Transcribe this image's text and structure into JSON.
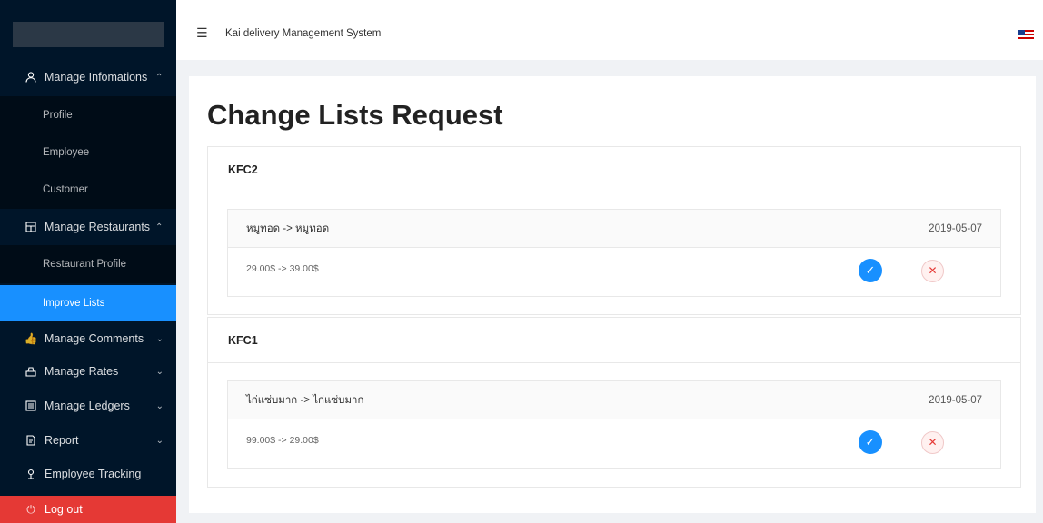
{
  "header": {
    "title": "Kai delivery Management System"
  },
  "sidebar": {
    "items": [
      {
        "label": "Manage Infomations",
        "icon": "user-icon",
        "arrow": "^"
      },
      {
        "label": "Profile"
      },
      {
        "label": "Employee"
      },
      {
        "label": "Customer"
      },
      {
        "label": "Manage Restaurants",
        "icon": "shop-icon",
        "arrow": "^"
      },
      {
        "label": "Restaurant Profile"
      },
      {
        "label": "Improve Lists"
      },
      {
        "label": "Manage Comments",
        "icon": "like-icon",
        "arrow": "v"
      },
      {
        "label": "Manage Rates",
        "icon": "rate-icon",
        "arrow": "v"
      },
      {
        "label": "Manage Ledgers",
        "icon": "ledger-icon",
        "arrow": "v"
      },
      {
        "label": "Report",
        "icon": "report-icon",
        "arrow": "v"
      },
      {
        "label": "Employee Tracking",
        "icon": "tracking-icon"
      },
      {
        "label": "Log out",
        "icon": "logout-icon"
      }
    ]
  },
  "main": {
    "title": "Change Lists Request",
    "cards": [
      {
        "restaurant": "KFC2",
        "name_change": "หมูทอด -> หมูทอด",
        "date": "2019-05-07",
        "price_change": "29.00$ -> 39.00$"
      },
      {
        "restaurant": "KFC1",
        "name_change": "ไก่แซ่บมาก -> ไก่แซ่บมาก",
        "date": "2019-05-07",
        "price_change": "99.00$ -> 29.00$"
      }
    ]
  },
  "colors": {
    "sidebar": "#001529",
    "active": "#1890ff",
    "logout": "#e53935"
  }
}
